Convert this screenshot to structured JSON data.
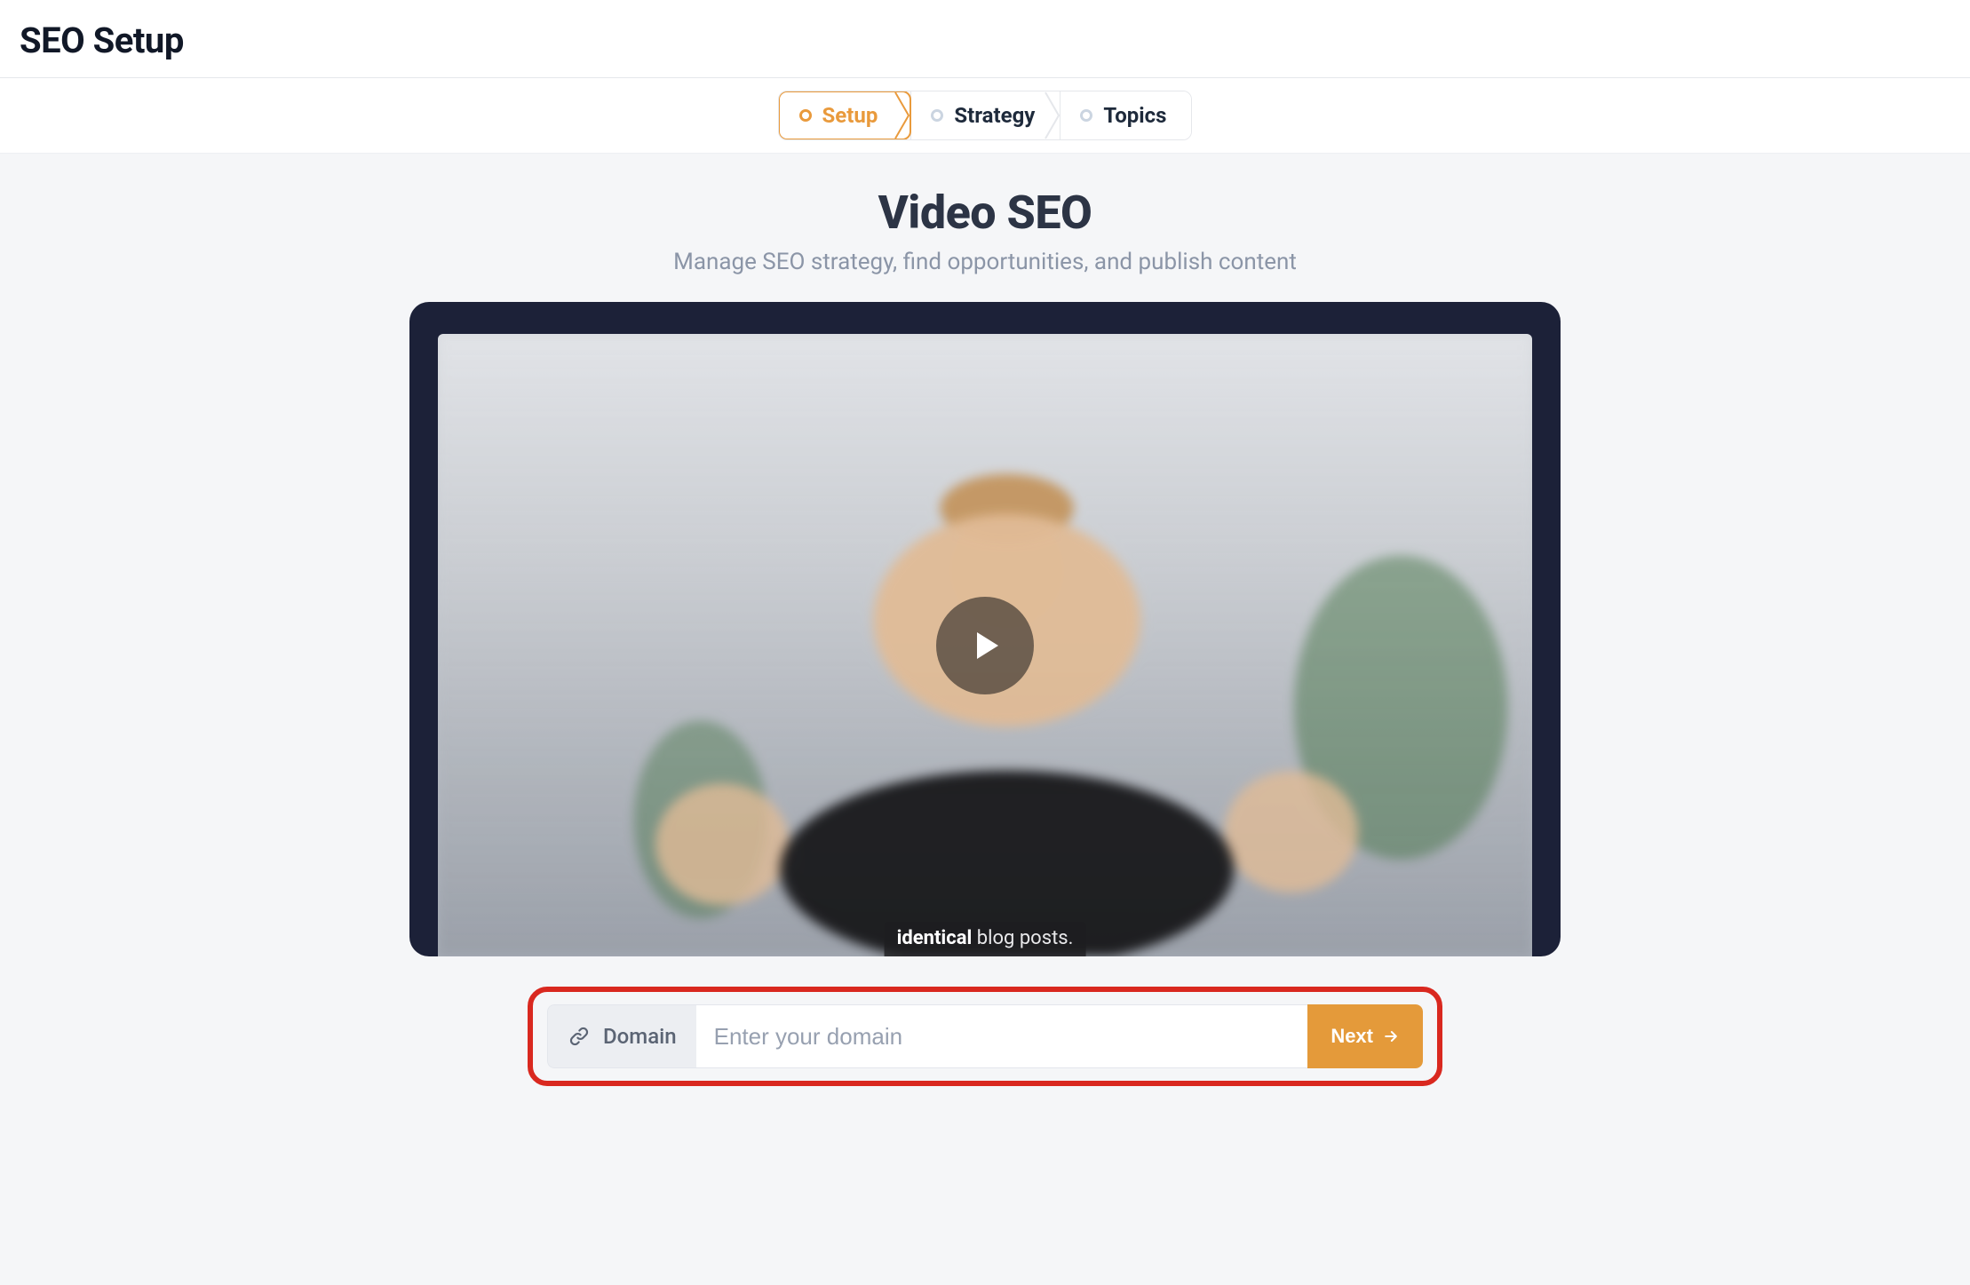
{
  "header": {
    "title": "SEO Setup"
  },
  "wizard": {
    "steps": [
      {
        "label": "Setup",
        "active": true
      },
      {
        "label": "Strategy",
        "active": false
      },
      {
        "label": "Topics",
        "active": false
      }
    ]
  },
  "hero": {
    "title": "Video SEO",
    "subtitle": "Manage SEO strategy, find opportunities, and publish content"
  },
  "video": {
    "caption_strong": "identical",
    "caption_rest": " blog posts."
  },
  "domain": {
    "prefix_label": "Domain",
    "placeholder": "Enter your domain",
    "value": "",
    "next_label": "Next"
  },
  "colors": {
    "accent": "#e49a3a",
    "highlight_border": "#d9281f",
    "text_muted": "#8b95a7",
    "video_bg": "#1c2138"
  }
}
